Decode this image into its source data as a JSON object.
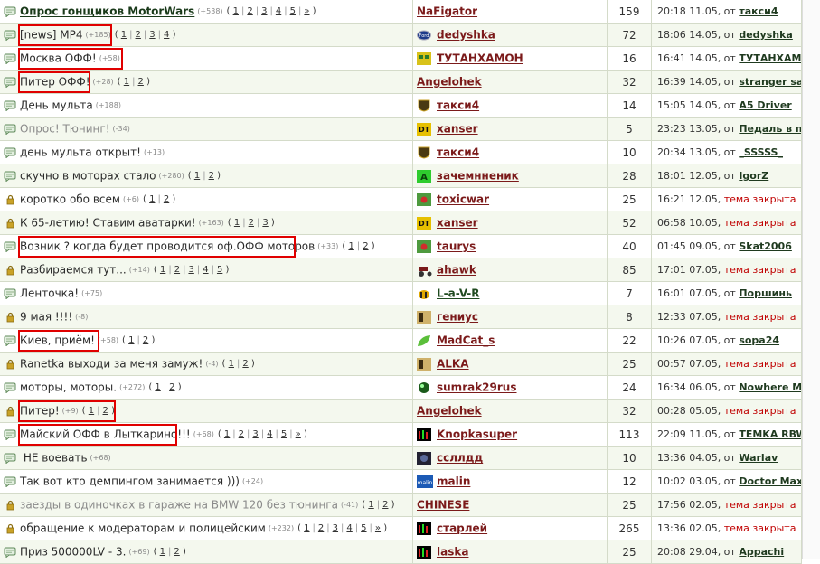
{
  "colors": {
    "accent_red": "#e00000",
    "closed": "#c00000",
    "row_alt": "#f4f8ee"
  },
  "topics": [
    {
      "icon": "speech-bubble-icon",
      "title": "Опрос гонщиков MotorWars",
      "style": "bold",
      "rep": "(+538)",
      "pages": [
        "1",
        "2",
        "3",
        "4",
        "5",
        "»"
      ],
      "author": "NaFigator",
      "author_style": "dark",
      "avatar": "",
      "count": "159",
      "last_time": "20:18 11.05, от",
      "last_user": "такси4",
      "hl": false
    },
    {
      "icon": "speech-bubble-icon",
      "title": "[news] MP4",
      "style": "",
      "rep": "(+185)",
      "pages": [
        "1",
        "2",
        "3",
        "4"
      ],
      "author": "dedyshka",
      "author_style": "dark",
      "avatar": "ford",
      "count": "72",
      "last_time": "18:06 14.05, от",
      "last_user": "dedyshka",
      "hl": true,
      "hlw": 100
    },
    {
      "icon": "speech-bubble-icon",
      "title": "Москва ОФФ!",
      "style": "",
      "rep": "(+58)",
      "pages": [],
      "author": "ТУТАНХАМОН",
      "author_style": "dark",
      "avatar": "face",
      "count": "16",
      "last_time": "16:41 14.05, от",
      "last_user": "ТУТАНХАМОН",
      "hl": true,
      "hlw": 112
    },
    {
      "icon": "speech-bubble-icon",
      "title": "Питер ОФФ!",
      "style": "",
      "rep": "(+28)",
      "pages": [
        "1",
        "2"
      ],
      "author": "Angelohek",
      "author_style": "dark",
      "avatar": "",
      "count": "32",
      "last_time": "16:39 14.05, от",
      "last_user": "stranger san",
      "hl": true,
      "hlw": 76
    },
    {
      "icon": "speech-bubble-icon",
      "title": "День мульта",
      "style": "",
      "rep": "(+188)",
      "pages": [],
      "author": "такси4",
      "author_style": "dark",
      "avatar": "shield",
      "count": "14",
      "last_time": "15:05 14.05, от",
      "last_user": "A5 Driver",
      "hl": false
    },
    {
      "icon": "speech-bubble-icon",
      "title": "Опрос! Тюнинг!",
      "style": "gray",
      "rep": "(-34)",
      "pages": [],
      "author": "xanser",
      "author_style": "dark",
      "avatar": "dt",
      "count": "5",
      "last_time": "23:23 13.05, от",
      "last_user": "Педаль в пол",
      "hl": false
    },
    {
      "icon": "speech-bubble-icon",
      "title": "день мульта открыт!",
      "style": "",
      "rep": "(+13)",
      "pages": [],
      "author": "такси4",
      "author_style": "dark",
      "avatar": "shield",
      "count": "10",
      "last_time": "20:34 13.05, от",
      "last_user": "_SSSSS_",
      "hl": false
    },
    {
      "icon": "speech-bubble-icon",
      "title": "скучно в моторах стало",
      "style": "",
      "rep": "(+280)",
      "pages": [
        "1",
        "2"
      ],
      "author": "зачемнненик",
      "author_style": "dark",
      "avatar": "green-a",
      "count": "28",
      "last_time": "18:01 12.05, от",
      "last_user": "IgorZ",
      "hl": false
    },
    {
      "icon": "lock-icon",
      "title": "коротко обо всем",
      "style": "",
      "rep": "(+6)",
      "pages": [
        "1",
        "2"
      ],
      "author": "toxicwar",
      "author_style": "dark",
      "avatar": "flower",
      "count": "25",
      "last_time": "16:21 12.05,",
      "last_user": "тема закрыта",
      "closed": true,
      "hl": false
    },
    {
      "icon": "lock-icon",
      "title": "К 65-летию! Ставим аватарки!",
      "style": "",
      "rep": "(+163)",
      "pages": [
        "1",
        "2",
        "3"
      ],
      "author": "xanser",
      "author_style": "dark",
      "avatar": "dt",
      "count": "52",
      "last_time": "06:58 10.05,",
      "last_user": "тема закрыта",
      "closed": true,
      "hl": false
    },
    {
      "icon": "speech-bubble-icon",
      "title": "Возник ? когда будет проводится оф.ОФФ моторов",
      "style": "",
      "rep": "(+33)",
      "pages": [
        "1",
        "2"
      ],
      "author": "taurys",
      "author_style": "dark",
      "avatar": "flower",
      "count": "40",
      "last_time": "01:45 09.05, от",
      "last_user": "Skat2006",
      "hl": true,
      "hlw": 303
    },
    {
      "icon": "lock-icon",
      "title": "Разбираемся тут...",
      "style": "",
      "rep": "(+14)",
      "pages": [
        "1",
        "2",
        "3",
        "4",
        "5"
      ],
      "author": "ahawk",
      "author_style": "dark",
      "avatar": "tractor",
      "count": "85",
      "last_time": "17:01 07.05,",
      "last_user": "тема закрыта",
      "closed": true,
      "hl": false
    },
    {
      "icon": "speech-bubble-icon",
      "title": "Ленточка!",
      "style": "",
      "rep": "(+75)",
      "pages": [],
      "author": "L-a-V-R",
      "author_style": "green",
      "avatar": "bee",
      "count": "7",
      "last_time": "16:01 07.05, от",
      "last_user": "Поршинь",
      "hl": false
    },
    {
      "icon": "lock-icon",
      "title": "9 мая !!!!",
      "style": "",
      "rep": "(-8)",
      "pages": [],
      "author": "гениус",
      "author_style": "dark",
      "avatar": "pic",
      "count": "8",
      "last_time": "12:33 07.05,",
      "last_user": "тема закрыта",
      "closed": true,
      "hl": false
    },
    {
      "icon": "speech-bubble-icon",
      "title": "Киев, приём!",
      "style": "",
      "rep": "(+58)",
      "pages": [
        "1",
        "2"
      ],
      "author": "MadCat_s",
      "author_style": "dark",
      "avatar": "leaf",
      "count": "22",
      "last_time": "10:26 07.05, от",
      "last_user": "sopa24",
      "hl": true,
      "hlw": 86
    },
    {
      "icon": "lock-icon",
      "title": "Ranetka выходи за меня замуж!",
      "style": "",
      "rep": "(-4)",
      "pages": [
        "1",
        "2"
      ],
      "author": "ALKA",
      "author_style": "dark",
      "avatar": "pic",
      "count": "25",
      "last_time": "00:57 07.05,",
      "last_user": "тема закрыта",
      "closed": true,
      "hl": false
    },
    {
      "icon": "speech-bubble-icon",
      "title": "моторы, моторы.",
      "style": "",
      "rep": "(+272)",
      "pages": [
        "1",
        "2"
      ],
      "author": "sumrak29rus",
      "author_style": "dark",
      "avatar": "ball",
      "count": "24",
      "last_time": "16:34 06.05, от",
      "last_user": "Nowhere Man",
      "hl": false
    },
    {
      "icon": "lock-icon",
      "title": "Питер!",
      "style": "",
      "rep": "(+9)",
      "pages": [
        "1",
        "2"
      ],
      "author": "Angelohek",
      "author_style": "dark",
      "avatar": "",
      "count": "32",
      "last_time": "00:28 05.05,",
      "last_user": "тема закрыта",
      "closed": true,
      "hl": true,
      "hlw": 104
    },
    {
      "icon": "speech-bubble-icon",
      "title": "Майский ОФФ в Лыткарино!!!",
      "style": "",
      "rep": "(+68)",
      "pages": [
        "1",
        "2",
        "3",
        "4",
        "5",
        "»"
      ],
      "author": "Knopkasuper",
      "author_style": "dark",
      "avatar": "bars",
      "count": "113",
      "last_time": "22:09 11.05, от",
      "last_user": "TEMKA RBW",
      "hl": true,
      "hlw": 172
    },
    {
      "icon": "speech-bubble-icon",
      "title": " НЕ воевать",
      "style": "",
      "rep": "(+68)",
      "pages": [],
      "author": "ссллдд",
      "author_style": "dark",
      "avatar": "dark",
      "count": "10",
      "last_time": "13:36 04.05, от",
      "last_user": "Warlav",
      "hl": false
    },
    {
      "icon": "speech-bubble-icon",
      "title": "Так вот кто демпингом занимается )))",
      "style": "",
      "rep": "(+24)",
      "pages": [],
      "author": "malin",
      "author_style": "dark",
      "avatar": "malin",
      "count": "12",
      "last_time": "10:02 03.05, от",
      "last_user": "Doctor MaxWeLL",
      "hl": false
    },
    {
      "icon": "lock-icon",
      "title": "заезды в одиночках в гараже на BMW 120 без тюнинга",
      "style": "gray",
      "rep": "(-41)",
      "pages": [
        "1",
        "2"
      ],
      "author": "CHINESE",
      "author_style": "dark",
      "avatar": "",
      "count": "25",
      "last_time": "17:56 02.05,",
      "last_user": "тема закрыта",
      "closed": true,
      "hl": false
    },
    {
      "icon": "lock-icon",
      "title": "обращение к модераторам и полицейским",
      "style": "",
      "rep": "(+232)",
      "pages": [
        "1",
        "2",
        "3",
        "4",
        "5",
        "»"
      ],
      "author": "старлей",
      "author_style": "dark",
      "avatar": "bars",
      "count": "265",
      "last_time": "13:36 02.05,",
      "last_user": "тема закрыта",
      "closed": true,
      "hl": false
    },
    {
      "icon": "speech-bubble-icon",
      "title": "Приз 500000LV - 3.",
      "style": "",
      "rep": "(+69)",
      "pages": [
        "1",
        "2"
      ],
      "author": "laska",
      "author_style": "dark",
      "avatar": "bars",
      "count": "25",
      "last_time": "20:08 29.04, от",
      "last_user": "Appachi",
      "hl": false
    }
  ]
}
